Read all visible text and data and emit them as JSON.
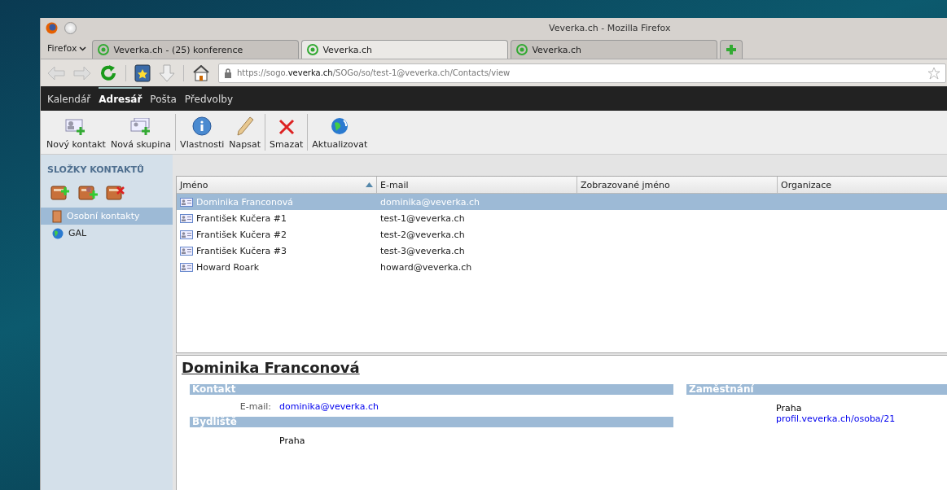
{
  "window": {
    "title": "Veverka.ch - Mozilla Firefox"
  },
  "browser_tabs": [
    {
      "label": "Veverka.ch - (25) konference",
      "selected": false
    },
    {
      "label": "Veverka.ch",
      "selected": true
    },
    {
      "label": "Veverka.ch",
      "selected": false
    }
  ],
  "firefox_menu": "Firefox",
  "address_bar": {
    "prefix": "https://sogo.",
    "domain": "veverka.ch",
    "path": "/SOGo/so/test-1@veverka.ch/Contacts/view"
  },
  "app_menu": [
    {
      "label": "Kalendář",
      "selected": false
    },
    {
      "label": "Adresář",
      "selected": true
    },
    {
      "label": "Pošta",
      "selected": false
    },
    {
      "label": "Předvolby",
      "selected": false
    }
  ],
  "toolbar": [
    {
      "label": "Nový kontakt",
      "kind": "new-contact"
    },
    {
      "label": "Nová skupina",
      "kind": "new-group"
    },
    {
      "label": "Vlastnosti",
      "kind": "info"
    },
    {
      "label": "Napsat",
      "kind": "pencil"
    },
    {
      "label": "Smazat",
      "kind": "delete"
    },
    {
      "label": "Aktualizovat",
      "kind": "refresh"
    }
  ],
  "sidebar": {
    "title": "SLOŽKY KONTAKTŮ",
    "items": [
      {
        "label": "Osobní kontakty",
        "kind": "book",
        "selected": true
      },
      {
        "label": "GAL",
        "kind": "globe",
        "selected": false
      }
    ]
  },
  "table": {
    "columns": [
      "Jméno",
      "E-mail",
      "Zobrazované jméno",
      "Organizace"
    ],
    "rows": [
      {
        "name": "Dominika Franconová",
        "email": "dominika@veverka.ch",
        "selected": true
      },
      {
        "name": "František Kučera #1",
        "email": "test-1@veverka.ch",
        "selected": false
      },
      {
        "name": "František Kučera #2",
        "email": "test-2@veverka.ch",
        "selected": false
      },
      {
        "name": "František Kučera #3",
        "email": "test-3@veverka.ch",
        "selected": false
      },
      {
        "name": "Howard Roark",
        "email": "howard@veverka.ch",
        "selected": false
      }
    ]
  },
  "detail": {
    "name": "Dominika Franconová",
    "contact": {
      "title": "Kontakt",
      "email_label": "E-mail:",
      "email": "dominika@veverka.ch"
    },
    "home": {
      "title": "Bydliště",
      "city": "Praha"
    },
    "work": {
      "title": "Zaměstnání",
      "city": "Praha",
      "url": "profil.veverka.ch/osoba/21"
    }
  }
}
